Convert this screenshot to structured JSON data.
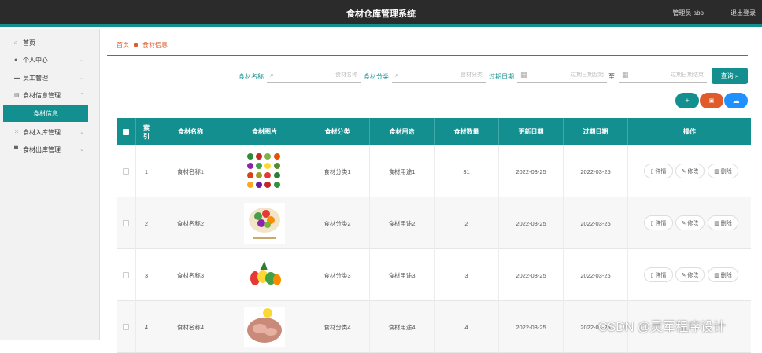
{
  "header": {
    "title": "食材仓库管理系统",
    "user": "管理员 abo",
    "logout": "退出登录"
  },
  "sidebar": {
    "items": [
      {
        "label": "首页",
        "icon": "home-icon"
      },
      {
        "label": "个人中心",
        "icon": "user-icon",
        "chev": "⌄"
      },
      {
        "label": "员工管理",
        "icon": "staff-icon",
        "chev": "⌄"
      },
      {
        "label": "食材信息管理",
        "icon": "food-icon",
        "chev": "⌄"
      },
      {
        "label": "食材入库管理",
        "icon": "inbound-icon",
        "chev": "⌄"
      },
      {
        "label": "食材出库管理",
        "icon": "outbound-icon",
        "chev": "⌄"
      }
    ],
    "sub": "食材信息"
  },
  "breadcrumb": {
    "home": "首页",
    "current": "食材信息"
  },
  "filters": {
    "name_label": "食材名称",
    "name_ph": "食材名称",
    "cat_label": "食材分类",
    "cat_ph": "食材分类",
    "date_label": "过期日期",
    "start_ph": "过期日期起始",
    "to": "至",
    "end_ph": "过期日期结束",
    "query": "查询"
  },
  "actions": {
    "add": "+",
    "del": "▣",
    "cloud": "☁"
  },
  "table": {
    "headers": [
      "",
      "索引",
      "食材名称",
      "食材图片",
      "食材分类",
      "食材用途",
      "食材数量",
      "更新日期",
      "过期日期",
      "操作"
    ],
    "rows": [
      {
        "idx": "1",
        "name": "食材名称1",
        "cat": "食材分类1",
        "use": "食材用途1",
        "qty": "31",
        "upd": "2022-03-25",
        "exp": "2022-03-25"
      },
      {
        "idx": "2",
        "name": "食材名称2",
        "cat": "食材分类2",
        "use": "食材用途2",
        "qty": "2",
        "upd": "2022-03-25",
        "exp": "2022-03-25"
      },
      {
        "idx": "3",
        "name": "食材名称3",
        "cat": "食材分类3",
        "use": "食材用途3",
        "qty": "3",
        "upd": "2022-03-25",
        "exp": "2022-03-25"
      },
      {
        "idx": "4",
        "name": "食材名称4",
        "cat": "食材分类4",
        "use": "食材用途4",
        "qty": "4",
        "upd": "2022-03-25",
        "exp": "2022-03-25"
      }
    ],
    "ops": {
      "detail": "详情",
      "edit": "修改",
      "delete": "删除"
    }
  },
  "watermark": "CSDN @灵军程序设计",
  "colors": {
    "teal": "#138f8f",
    "orange": "#e05a2a",
    "blue": "#1e90ff"
  }
}
